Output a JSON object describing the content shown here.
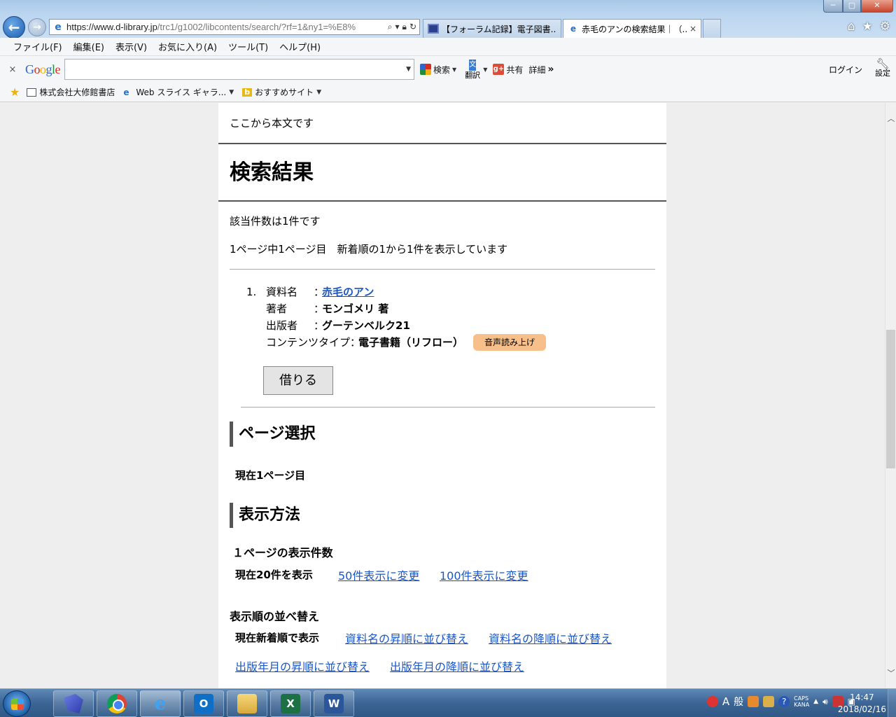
{
  "browser": {
    "address_prefix": "https://www.",
    "address_domain": "d-library.jp",
    "address_rest": "/trc1/g1002/libcontents/search/?rf=1&ny1=%E8%",
    "tabs": [
      {
        "title": "【フォーラム記録】電子図書...",
        "icon": "forum-icon"
      },
      {
        "title": "赤毛のアンの検索結果｜（...",
        "icon": "ie-icon",
        "close": "×"
      }
    ],
    "menu": [
      "ファイル(F)",
      "編集(E)",
      "表示(V)",
      "お気に入り(A)",
      "ツール(T)",
      "ヘルプ(H)"
    ],
    "google_toolbar": {
      "close": "×",
      "search_label": "検索",
      "translate_label": "翻訳",
      "share_label": "共有",
      "more_label": "詳細",
      "more_glyph": "»",
      "login_label": "ログイン",
      "settings_label": "設定"
    },
    "favorites": [
      {
        "label": "株式会社大修館書店",
        "icon": "book-icon"
      },
      {
        "label": "Web スライス ギャラ...",
        "icon": "ie-icon",
        "has_menu": true
      },
      {
        "label": "おすすめサイト",
        "icon": "bing-icon",
        "has_menu": true
      }
    ]
  },
  "page": {
    "skip_text": "ここから本文です",
    "heading": "検索結果",
    "count_text": "該当件数は1件です",
    "page_info": "1ページ中1ページ目　新着順の1から1件を表示しています",
    "result": {
      "number": "1.",
      "title_label": "資料名",
      "title": "赤毛のアン",
      "author_label": "著者",
      "author": "モンゴメリ 著",
      "publisher_label": "出版者",
      "publisher": "グーテンベルク21",
      "content_type_label": "コンテンツタイプ",
      "content_type": "電子書籍（リフロー）",
      "badge": "音声読み上げ",
      "colon": "："
    },
    "borrow_button": "借りる",
    "page_select_heading": "ページ選択",
    "current_page": "現在1ページ目",
    "display_heading": "表示方法",
    "per_page_heading": "１ページの表示件数",
    "per_page_current": "現在20件を表示",
    "per_page_links": [
      "50件表示に変更",
      "100件表示に変更"
    ],
    "sort_heading": "表示順の並べ替え",
    "sort_current": "現在新着順で表示",
    "sort_links": [
      "資料名の昇順に並び替え",
      "資料名の降順に並び替え",
      "出版年月の昇順に並び替え",
      "出版年月の降順に並び替え"
    ]
  },
  "taskbar": {
    "apps": [
      "visual-studio-icon",
      "chrome-icon",
      "internet-explorer-icon",
      "outlook-icon",
      "file-explorer-icon",
      "excel-icon",
      "word-icon"
    ],
    "ime_a": "A",
    "ime_mode": "般",
    "caps": "CAPS",
    "kana": "KANA",
    "time": "14:47",
    "date": "2018/02/16"
  },
  "colors": {
    "link": "#1a56c8",
    "badge": "#f7c08a"
  }
}
